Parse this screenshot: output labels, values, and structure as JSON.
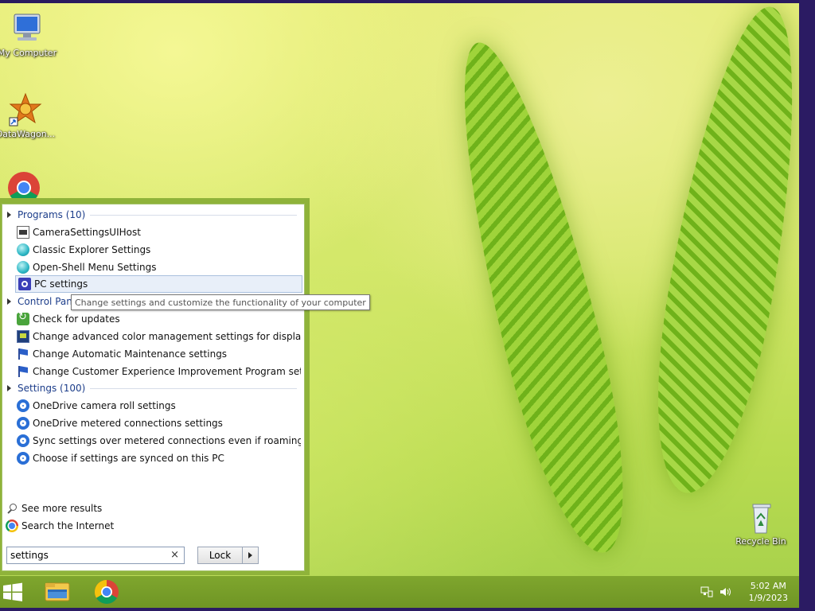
{
  "desktop": {
    "icons": [
      {
        "label": "My Computer",
        "icon": "computer-icon"
      },
      {
        "label": "DataWagon...",
        "icon": "datawagon-icon"
      },
      {
        "label": "",
        "icon": "chrome-icon"
      },
      {
        "label": "Recycle Bin",
        "icon": "recycle-bin-icon"
      }
    ]
  },
  "start_menu": {
    "programs_header": "Programs (10)",
    "programs": [
      {
        "label": "CameraSettingsUIHost",
        "icon": "window-icon"
      },
      {
        "label": "Classic Explorer Settings",
        "icon": "shell-icon"
      },
      {
        "label": "Open-Shell Menu Settings",
        "icon": "shell-icon"
      },
      {
        "label": "PC settings",
        "icon": "pc-settings-icon"
      }
    ],
    "control_panel_header": "Control Panel (16)",
    "control_panel": [
      {
        "label": "Check for updates",
        "icon": "update-icon"
      },
      {
        "label": "Change advanced color management settings for displays, sca...",
        "icon": "monitor-icon"
      },
      {
        "label": "Change Automatic Maintenance settings",
        "icon": "flag-icon"
      },
      {
        "label": "Change Customer Experience Improvement Program settings",
        "icon": "flag-icon"
      }
    ],
    "settings_header": "Settings (100)",
    "settings": [
      {
        "label": "OneDrive camera roll settings",
        "icon": "gear-icon"
      },
      {
        "label": "OneDrive metered connections settings",
        "icon": "gear-icon"
      },
      {
        "label": "Sync settings over metered connections even if roaming",
        "icon": "gear-icon"
      },
      {
        "label": "Choose if settings are synced on this PC",
        "icon": "gear-icon"
      }
    ],
    "see_more": "See more results",
    "search_internet": "Search the Internet",
    "search_value": "settings",
    "clear_symbol": "×",
    "lock_label": "Lock",
    "tooltip": "Change settings and customize the functionality of your computer"
  },
  "taskbar": {
    "time": "5:02 AM",
    "date": "1/9/2023"
  },
  "colors": {
    "header_text": "#1c3d8a",
    "taskbar": "#7fa62e",
    "menu_frame": "#8fb33a"
  }
}
